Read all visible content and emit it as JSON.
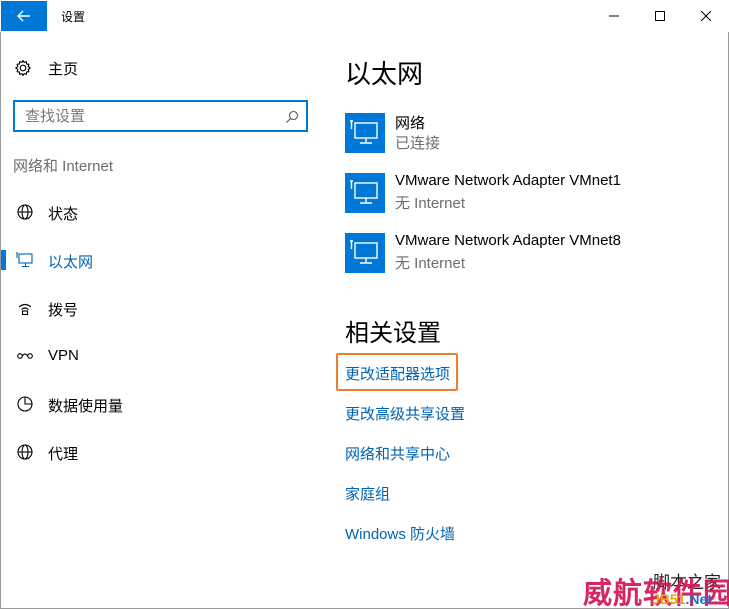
{
  "window": {
    "title": "设置"
  },
  "sidebar": {
    "home_label": "主页",
    "search_placeholder": "查找设置",
    "section_label": "网络和 Internet",
    "items": [
      {
        "label": "状态",
        "icon": "globe-icon"
      },
      {
        "label": "以太网",
        "icon": "ethernet-icon",
        "active": true
      },
      {
        "label": "拨号",
        "icon": "dialup-icon"
      },
      {
        "label": "VPN",
        "icon": "vpn-icon"
      },
      {
        "label": "数据使用量",
        "icon": "data-usage-icon"
      },
      {
        "label": "代理",
        "icon": "proxy-globe-icon"
      }
    ]
  },
  "main": {
    "heading": "以太网",
    "adapters": [
      {
        "name": "网络",
        "status": "已连接"
      },
      {
        "name": "VMware Network Adapter VMnet1",
        "status": "无 Internet"
      },
      {
        "name": "VMware Network Adapter VMnet8",
        "status": "无 Internet"
      }
    ],
    "related_heading": "相关设置",
    "related_links": [
      "更改适配器选项",
      "更改高级共享设置",
      "网络和共享中心",
      "家庭组",
      "Windows 防火墙"
    ]
  },
  "watermark": {
    "top": "脚本之家",
    "main": "威航软件园",
    "bottom_a": "JB51",
    "bottom_b": ".Net"
  },
  "colors": {
    "accent": "#0078d7",
    "link": "#0063b1",
    "highlight_border": "#ed7d31",
    "watermark": "#d4145a"
  }
}
